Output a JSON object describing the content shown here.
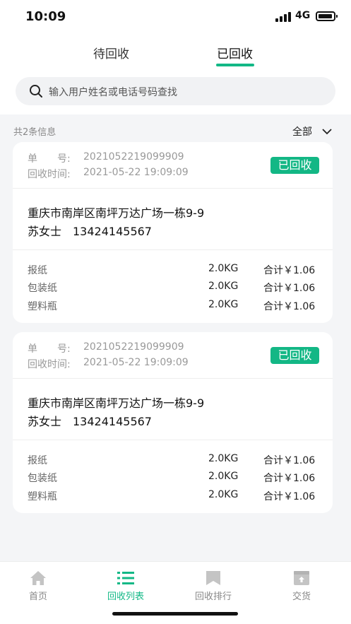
{
  "status_bar": {
    "time": "10:09",
    "network": "4G"
  },
  "tabs": [
    {
      "label": "待回收",
      "active": false
    },
    {
      "label": "已回收",
      "active": true
    }
  ],
  "search": {
    "placeholder": "输入用户姓名或电话号码查找"
  },
  "summary": {
    "count_text": "共2条信息",
    "filter_label": "全部"
  },
  "orders": [
    {
      "order_label": "单　　号:",
      "order_no": "2021052219099909",
      "time_label": "回收时间:",
      "time": "2021-05-22 19:09:09",
      "status": "已回收",
      "address": "重庆市南岸区南坪万达广场一栋9-9",
      "contact": "苏女士　13424145567",
      "items": [
        {
          "name": "报纸",
          "qty": "2.0KG",
          "total": "合计￥1.06"
        },
        {
          "name": "包装纸",
          "qty": "2.0KG",
          "total": "合计￥1.06"
        },
        {
          "name": "塑料瓶",
          "qty": "2.0KG",
          "total": "合计￥1.06"
        }
      ]
    },
    {
      "order_label": "单　　号:",
      "order_no": "2021052219099909",
      "time_label": "回收时间:",
      "time": "2021-05-22 19:09:09",
      "status": "已回收",
      "address": "重庆市南岸区南坪万达广场一栋9-9",
      "contact": "苏女士　13424145567",
      "items": [
        {
          "name": "报纸",
          "qty": "2.0KG",
          "total": "合计￥1.06"
        },
        {
          "name": "包装纸",
          "qty": "2.0KG",
          "total": "合计￥1.06"
        },
        {
          "name": "塑料瓶",
          "qty": "2.0KG",
          "total": "合计￥1.06"
        }
      ]
    }
  ],
  "bottom_nav": [
    {
      "label": "首页",
      "icon": "home-icon"
    },
    {
      "label": "回收列表",
      "icon": "list-icon",
      "active": true
    },
    {
      "label": "回收排行",
      "icon": "bookmark-icon"
    },
    {
      "label": "交货",
      "icon": "delivery-box-icon"
    }
  ],
  "colors": {
    "accent": "#12b886",
    "badge": "#13b785",
    "background": "#f4f5f7"
  }
}
